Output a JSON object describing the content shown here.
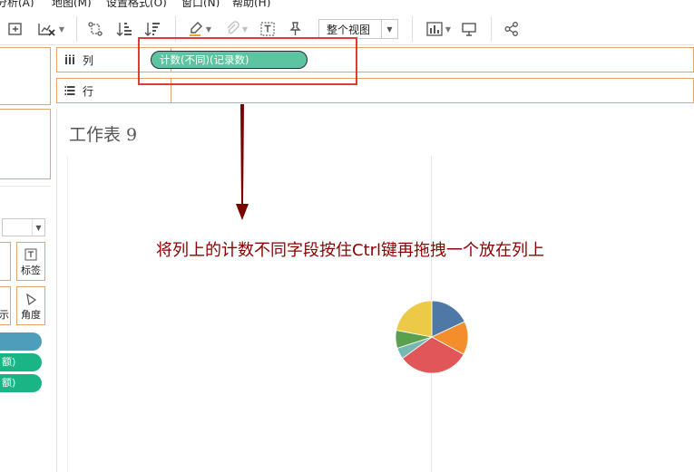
{
  "menu": {
    "items": [
      "分析(A)",
      "地图(M)",
      "设置格式(O)",
      "窗口(N)",
      "帮助(H)"
    ]
  },
  "toolbar": {
    "view_select": "整个视图",
    "icons": [
      "data-source-icon",
      "clear-sheet-icon",
      "swap-icon",
      "sort-asc-icon",
      "sort-desc-icon",
      "highlight-icon",
      "group-icon",
      "label-icon",
      "pin-icon",
      "show-me-icon",
      "presentation-icon",
      "share-icon"
    ]
  },
  "shelves": {
    "columns_label": "列",
    "rows_label": "行",
    "column_pill": "计数(不同)(记录数)",
    "column_pill_ghost": "录数)"
  },
  "marks": {
    "label_card": "标签",
    "detail_card_partial": "示",
    "angle_card": "角度",
    "pills": [
      "",
      "额)",
      "额)"
    ],
    "pill_colors": [
      "#4e9dbb",
      "#1ab585",
      "#1ab585"
    ]
  },
  "sheet": {
    "title": "工作表 9"
  },
  "annotation": {
    "text": "将列上的计数不同字段按住Ctrl键再拖拽一个放在列上",
    "color": "#8b0000"
  },
  "chart_data": {
    "type": "pie",
    "slices": [
      {
        "value": 18,
        "color": "#4e79a7"
      },
      {
        "value": 15,
        "color": "#f28e2b"
      },
      {
        "value": 32,
        "color": "#e15759"
      },
      {
        "value": 5,
        "color": "#76b7b2"
      },
      {
        "value": 8,
        "color": "#59a14f"
      },
      {
        "value": 22,
        "color": "#edc948"
      }
    ]
  }
}
